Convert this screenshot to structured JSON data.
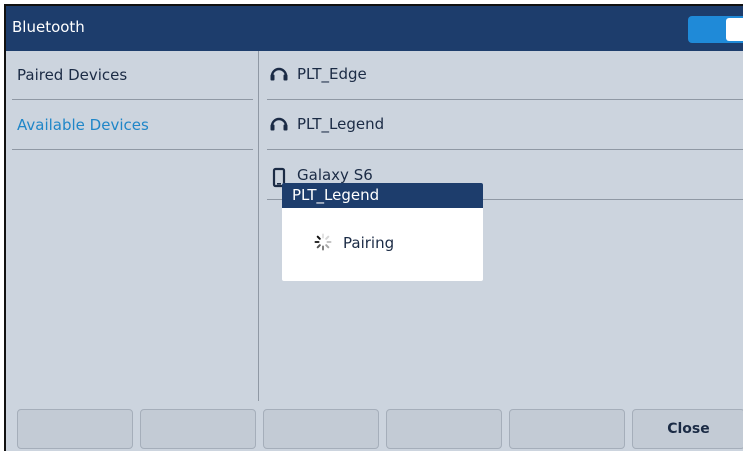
{
  "titlebar": {
    "title": "Bluetooth",
    "toggle_on": true
  },
  "left_menu": {
    "items": [
      {
        "label": "Paired Devices",
        "selected": false
      },
      {
        "label": "Available Devices",
        "selected": true
      }
    ]
  },
  "devices": [
    {
      "name": "PLT_Edge",
      "icon": "headset-icon"
    },
    {
      "name": "PLT_Legend",
      "icon": "headset-icon"
    },
    {
      "name": "Galaxy S6",
      "icon": "phone-icon"
    }
  ],
  "dialog": {
    "title": "PLT_Legend",
    "message": "Pairing",
    "icon": "spinner-icon"
  },
  "softkeys": [
    "",
    "",
    "",
    "",
    "",
    "Close"
  ],
  "colors": {
    "header": "#1d3d6c",
    "background": "#ccd4de",
    "accent": "#1f86c8",
    "toggle": "#1f8ad8"
  }
}
